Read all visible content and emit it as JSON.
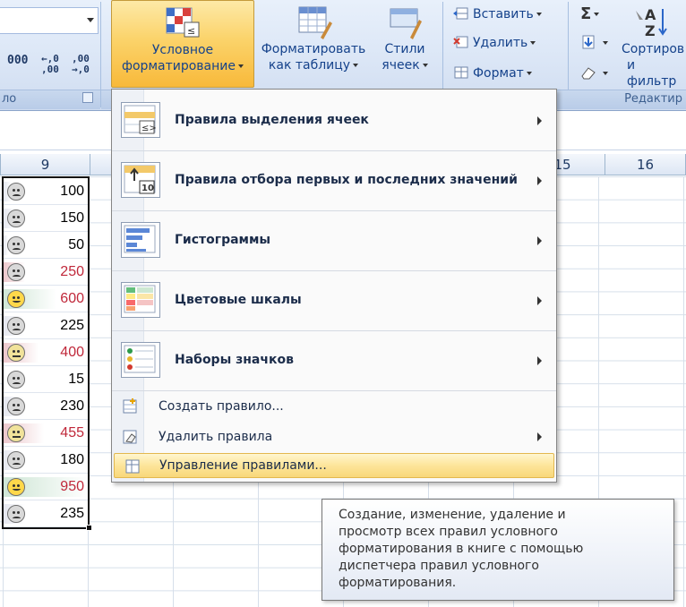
{
  "ribbon": {
    "number_group_label": "ло",
    "number_formats": [
      "000",
      ",00\n,0",
      ",00\n,0"
    ],
    "conditional_formatting": {
      "label_line1": "Условное",
      "label_line2": "форматирование"
    },
    "format_as_table": {
      "label_line1": "Форматировать",
      "label_line2": "как таблицу"
    },
    "cell_styles": {
      "label_line1": "Стили",
      "label_line2": "ячеек"
    },
    "cells": {
      "insert": "Вставить",
      "delete": "Удалить",
      "format": "Формат"
    },
    "editing": {
      "sum_symbol": "Σ",
      "sort_line1": "Сортиров",
      "sort_line2": "и фильтр",
      "group_label": "Редактир"
    }
  },
  "sheet": {
    "columns": [
      "9",
      "15",
      "16"
    ],
    "rows": [
      {
        "value": "100",
        "face": "sad",
        "color": "#000000",
        "bar": 0.1,
        "bar_color": "#e5e7ef"
      },
      {
        "value": "150",
        "face": "sad",
        "color": "#000000",
        "bar": 0.15,
        "bar_color": "#e5e7ef"
      },
      {
        "value": "50",
        "face": "sad",
        "color": "#000000",
        "bar": 0.05,
        "bar_color": "#e5e7ef"
      },
      {
        "value": "250",
        "face": "sad",
        "color": "#c0283a",
        "bar": 0.26,
        "bar_color": "#ecc7cc"
      },
      {
        "value": "600",
        "face": "happy",
        "color": "#c0283a",
        "bar": 0.63,
        "bar_color": "#cfe6d6"
      },
      {
        "value": "225",
        "face": "sad",
        "color": "#000000",
        "bar": 0.24,
        "bar_color": "#e5e7ef"
      },
      {
        "value": "400",
        "face": "neutral",
        "color": "#c0283a",
        "bar": 0.42,
        "bar_color": "#ecc7cc"
      },
      {
        "value": "15",
        "face": "sad",
        "color": "#000000",
        "bar": 0.02,
        "bar_color": "#e5e7ef"
      },
      {
        "value": "230",
        "face": "sad",
        "color": "#000000",
        "bar": 0.24,
        "bar_color": "#e5e7ef"
      },
      {
        "value": "455",
        "face": "neutral",
        "color": "#c0283a",
        "bar": 0.48,
        "bar_color": "#ecc7cc"
      },
      {
        "value": "180",
        "face": "sad",
        "color": "#000000",
        "bar": 0.19,
        "bar_color": "#e5e7ef"
      },
      {
        "value": "950",
        "face": "happy",
        "color": "#c0283a",
        "bar": 1.0,
        "bar_color": "#cfe6d6"
      },
      {
        "value": "235",
        "face": "sad",
        "color": "#000000",
        "bar": 0.25,
        "bar_color": "#e5e7ef"
      }
    ]
  },
  "menu": {
    "items": [
      {
        "label": "Правила выделения ячеек",
        "icon": "highlight-rules-icon"
      },
      {
        "label": "Правила отбора первых и последних значений",
        "icon": "top-bottom-rules-icon"
      },
      {
        "label": "Гистограммы",
        "icon": "data-bars-icon"
      },
      {
        "label": "Цветовые шкалы",
        "icon": "color-scales-icon"
      },
      {
        "label": "Наборы значков",
        "icon": "icon-sets-icon"
      }
    ],
    "new_rule": "Создать правило...",
    "clear_rules": "Удалить правила",
    "manage_rules": "Управление правилами..."
  },
  "tooltip": {
    "lines": [
      "Создание, изменение, удаление и",
      "просмотр всех правил условного",
      "форматирования в книге с помощью",
      "диспетчера правил условного",
      "форматирования."
    ]
  }
}
